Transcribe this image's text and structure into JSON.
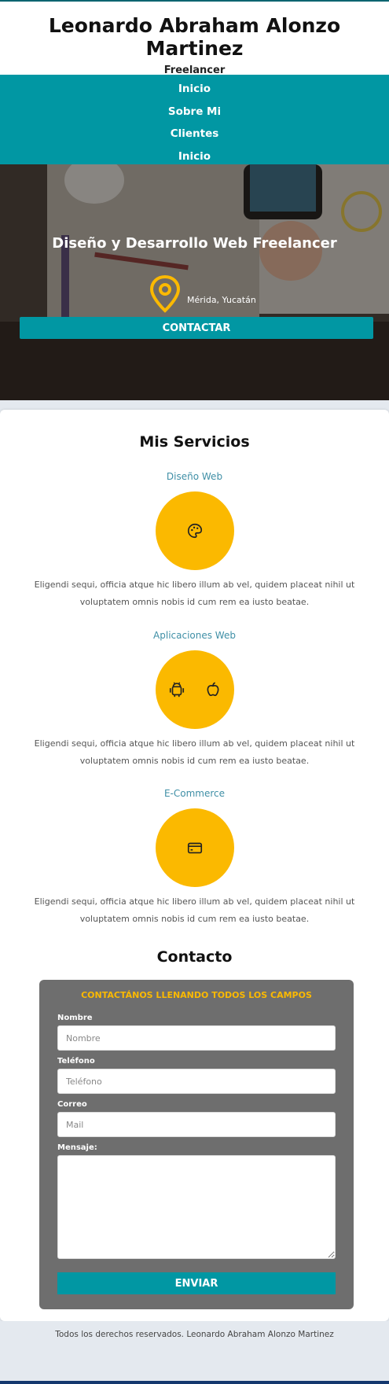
{
  "header": {
    "title": "Leonardo Abraham Alonzo Martinez",
    "subtitle": "Freelancer"
  },
  "nav": {
    "items": [
      {
        "label": "Inicio"
      },
      {
        "label": "Sobre Mi"
      },
      {
        "label": "Clientes"
      },
      {
        "label": "Inicio"
      }
    ]
  },
  "hero": {
    "title": "Diseño y Desarrollo Web Freelancer",
    "location": "Mérida, Yucatán",
    "location_icon": "map-pin-icon",
    "cta_label": "CONTACTAR"
  },
  "services": {
    "title": "Mis Servicios",
    "items": [
      {
        "name": "Diseño Web",
        "icons": [
          "palette-icon"
        ],
        "description": "Eligendi sequi, officia atque hic libero illum ab vel, quidem placeat nihil ut voluptatem omnis nobis id cum rem ea iusto beatae."
      },
      {
        "name": "Aplicaciones Web",
        "icons": [
          "android-icon",
          "apple-icon"
        ],
        "description": "Eligendi sequi, officia atque hic libero illum ab vel, quidem placeat nihil ut voluptatem omnis nobis id cum rem ea iusto beatae."
      },
      {
        "name": "E-Commerce",
        "icons": [
          "credit-card-icon"
        ],
        "description": "Eligendi sequi, officia atque hic libero illum ab vel, quidem placeat nihil ut voluptatem omnis nobis id cum rem ea iusto beatae."
      }
    ]
  },
  "contact": {
    "title": "Contacto",
    "form_heading": "CONTACTÁNOS LLENANDO TODOS LOS CAMPOS",
    "fields": {
      "name": {
        "label": "Nombre",
        "placeholder": "Nombre",
        "value": ""
      },
      "phone": {
        "label": "Teléfono",
        "placeholder": "Teléfono",
        "value": ""
      },
      "email": {
        "label": "Correo",
        "placeholder": "Mail",
        "value": ""
      },
      "message": {
        "label": "Mensaje:",
        "placeholder": "",
        "value": ""
      }
    },
    "submit_label": "ENVIAR"
  },
  "footer": {
    "text": "Todos los derechos reservados. Leonardo Abraham Alonzo Martinez"
  },
  "colors": {
    "accent": "#0197a3",
    "highlight": "#fbb900",
    "service_name": "#3f8fa6",
    "form_bg": "#6e6e6e",
    "page_bg": "#e4e9ef"
  }
}
